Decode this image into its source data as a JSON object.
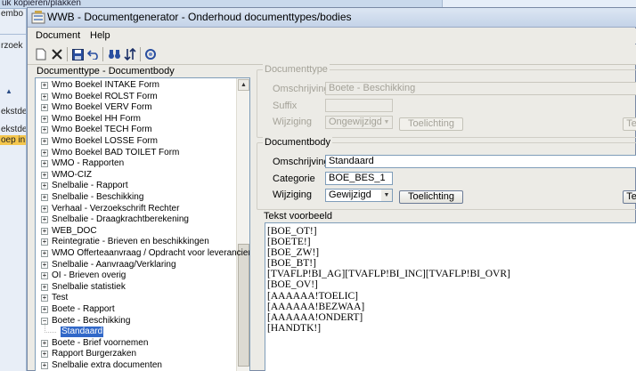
{
  "background": {
    "top_text": "uk kopiëren/plakken",
    "left_rows": [
      "embo",
      "rzoek",
      "ekstdel",
      "ekstdel",
      "oep in"
    ]
  },
  "window": {
    "title": "WWB - Documentgenerator - Onderhoud documenttypes/bodies"
  },
  "menu": [
    "Document",
    "Help"
  ],
  "toolbar": [
    "new-icon",
    "delete-icon",
    "save-icon",
    "undo-icon",
    "binoculars-icon",
    "sort-icon",
    "refresh-icon"
  ],
  "tree": {
    "label": "Documenttype - Documentbody",
    "items": [
      {
        "label": "Wmo Boekel INTAKE Form",
        "expander": "+"
      },
      {
        "label": "Wmo Boekel ROLST Form",
        "expander": "+"
      },
      {
        "label": "Wmo Boekel VERV Form",
        "expander": "+"
      },
      {
        "label": "Wmo Boekel HH Form",
        "expander": "+"
      },
      {
        "label": "Wmo Boekel TECH Form",
        "expander": "+"
      },
      {
        "label": "Wmo Boekel LOSSE Form",
        "expander": "+"
      },
      {
        "label": "Wmo Boekel BAD TOILET Form",
        "expander": "+"
      },
      {
        "label": "WMO - Rapporten",
        "expander": "+"
      },
      {
        "label": "WMO-CIZ",
        "expander": "+"
      },
      {
        "label": "Snelbalie - Rapport",
        "expander": "+"
      },
      {
        "label": "Snelbalie - Beschikking",
        "expander": "+"
      },
      {
        "label": "Verhaal - Verzoekschrift Rechter",
        "expander": "+"
      },
      {
        "label": "Snelbalie - Draagkrachtberekening",
        "expander": "+"
      },
      {
        "label": "WEB_DOC",
        "expander": "+"
      },
      {
        "label": "Reintegratie - Brieven en beschikkingen",
        "expander": "+"
      },
      {
        "label": "WMO Offerteaanvraag / Opdracht voor leverancier",
        "expander": "+"
      },
      {
        "label": "Snelbalie - Aanvraag/Verklaring",
        "expander": "+"
      },
      {
        "label": "OI - Brieven overig",
        "expander": "+"
      },
      {
        "label": "Snelbalie statistiek",
        "expander": "+"
      },
      {
        "label": "Test",
        "expander": "+"
      },
      {
        "label": "Boete - Rapport",
        "expander": "+"
      },
      {
        "label": "Boete - Beschikking",
        "expander": "−"
      },
      {
        "label": "Standaard",
        "expander": "",
        "child": true,
        "selected": true
      },
      {
        "label": "Boete - Brief voornemen",
        "expander": "+"
      },
      {
        "label": "Rapport Burgerzaken",
        "expander": "+"
      },
      {
        "label": "Snelbalie extra documenten",
        "expander": "+"
      }
    ]
  },
  "documenttype": {
    "legend": "Documenttype",
    "omschrijving_label": "Omschrijving",
    "omschrijving_value": "Boete - Beschikking",
    "suffix_label": "Suffix",
    "suffix_value": "",
    "wijziging_label": "Wijziging",
    "wijziging_value": "Ongewijzigd",
    "toelichting_button": "Toelichting",
    "extra_button": "Te"
  },
  "documentbody": {
    "legend": "Documentbody",
    "omschrijving_label": "Omschrijving",
    "omschrijving_value": "Standaard",
    "categorie_label": "Categorie",
    "categorie_value": "BOE_BES_1",
    "wijziging_label": "Wijziging",
    "wijziging_value": "Gewijzigd",
    "toelichting_button": "Toelichting",
    "extra_button": "Te"
  },
  "preview": {
    "legend": "Tekst voorbeeld",
    "text": "[BOE_OT!]\n[BOETE!]\n[BOE_ZW!]\n[BOE_BT!]\n[TVAFLP!BI_AG][TVAFLP!BI_INC][TVAFLP!BI_OVR]\n[BOE_OV!]\n[AAAAAA!TOELIC]\n[AAAAAA!BEZWAA]\n[AAAAAA!ONDERT]\n[HANDTK!]"
  }
}
